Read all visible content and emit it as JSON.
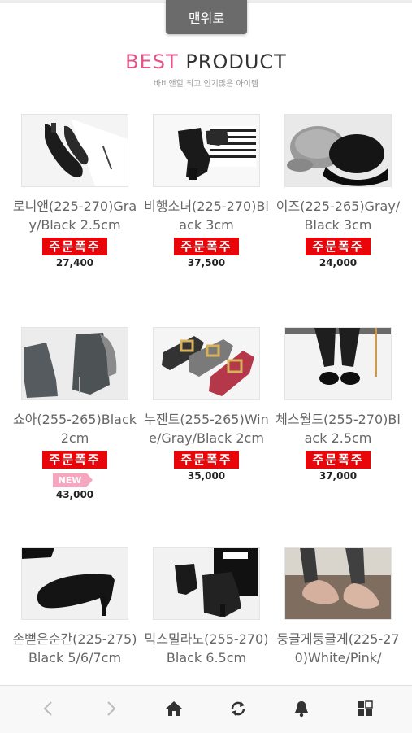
{
  "to_top_label": "맨위로",
  "section": {
    "title_accent": "BEST",
    "title_rest": " PRODUCT",
    "subtitle": "바비앤힐 최고 인기많은 아이템"
  },
  "products": [
    {
      "name": "로니앤(225-270)Gray/Black 2.5cm",
      "badge": "주문폭주",
      "price": "27,400"
    },
    {
      "name": "비행소녀(225-270)Black 3cm",
      "badge": "주문폭주",
      "price": "37,500"
    },
    {
      "name": "이즈(225-265)Gray/Black 3cm",
      "badge": "주문폭주",
      "price": "24,000"
    },
    {
      "name": "쇼아(255-265)Black 2cm",
      "badge": "주문폭주",
      "new": "NEW",
      "price": "43,000"
    },
    {
      "name": "누젠트(255-265)Wine/Gray/Black 2cm",
      "badge": "주문폭주",
      "price": "35,000"
    },
    {
      "name": "체스월드(255-270)Black 2.5cm",
      "badge": "주문폭주",
      "price": "37,000"
    },
    {
      "name": "손뻗은순간(225-275)Black 5/6/7cm"
    },
    {
      "name": "믹스밀라노(255-270)Black 6.5cm"
    },
    {
      "name": "둥글게둥글게(225-270)White/Pink/"
    }
  ],
  "bottom_nav": {
    "icons": [
      "chevron-left-icon",
      "chevron-right-icon",
      "home-icon",
      "refresh-icon",
      "bell-icon",
      "grid-icon"
    ],
    "colors": {
      "disabled": "#bbbbbb",
      "active": "#333333"
    }
  },
  "colors": {
    "accent": "#e2568a",
    "badge": "#e8060a",
    "new_tag": "#f7a6c0"
  }
}
